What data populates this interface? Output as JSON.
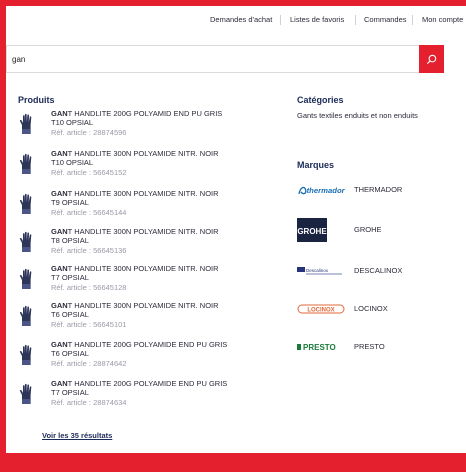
{
  "topnav": {
    "purchase_requests": "Demandes d'achat",
    "favorites": "Listes de favoris",
    "orders": "Commandes",
    "account": "Mon compte"
  },
  "search": {
    "value": "gan",
    "button_icon": "search-icon"
  },
  "products": {
    "heading": "Produits",
    "items": [
      {
        "bold": "GAN",
        "rest": "T HANDLITE 200G POLYAMID END PU GRIS",
        "line2": "T10 OPSIAL",
        "ref": "Réf. article : 28874596"
      },
      {
        "bold": "GAN",
        "rest": "T HANDLITE 300N POLYAMIDE NITR. NOIR",
        "line2": "T10 OPSIAL",
        "ref": "Réf. article : 56645152"
      },
      {
        "bold": "GAN",
        "rest": "T HANDLITE 300N POLYAMIDE NITR. NOIR",
        "line2": "T9 OPSIAL",
        "ref": "Réf. article : 56645144"
      },
      {
        "bold": "GAN",
        "rest": "T HANDLITE 300N POLYAMIDE NITR. NOIR",
        "line2": "T8 OPSIAL",
        "ref": "Réf. article : 56645136"
      },
      {
        "bold": "GAN",
        "rest": "T HANDLITE 300N POLYAMIDE NITR. NOIR",
        "line2": "T7 OPSIAL",
        "ref": "Réf. article : 56645128"
      },
      {
        "bold": "GAN",
        "rest": "T HANDLITE 300N POLYAMIDE NITR. NOIR",
        "line2": "T6 OPSIAL",
        "ref": "Réf. article : 56645101"
      },
      {
        "bold": "GAN",
        "rest": "T HANDLITE 200G POLYAMIDE END PU GRIS",
        "line2": "T6 OPSIAL",
        "ref": "Réf. article : 28874642"
      },
      {
        "bold": "GAN",
        "rest": "T HANDLITE 200G POLYAMIDE END PU GRIS",
        "line2": "T7 OPSIAL",
        "ref": "Réf. article : 28874634"
      }
    ],
    "see_all": "Voir les 35 résultats"
  },
  "categories": {
    "heading": "Catégories",
    "items": [
      "Gants textiles enduits et non enduits"
    ]
  },
  "brands": {
    "heading": "Marques",
    "items": [
      {
        "name": "THERMADOR",
        "logo_text": "thermador"
      },
      {
        "name": "GROHE",
        "logo_text": "GROHE"
      },
      {
        "name": "DESCALINOX",
        "logo_text": "Descalinox"
      },
      {
        "name": "LOCINOX",
        "logo_text": "LOCINOX"
      },
      {
        "name": "PRESTO",
        "logo_text": "PRESTO"
      }
    ]
  },
  "colors": {
    "accent": "#e5202e",
    "heading": "#1b2a57"
  }
}
